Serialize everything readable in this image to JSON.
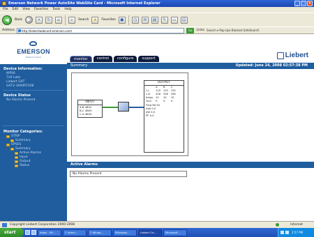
{
  "window": {
    "title": "Emerson Network Power AutoSite WebSite Card - Microsoft Internet Explorer"
  },
  "menu": [
    "File",
    "Edit",
    "View",
    "Favorites",
    "Tools",
    "Help"
  ],
  "toolbar": {
    "back": "Back",
    "search": "Search",
    "favorites": "Favorites"
  },
  "address": {
    "label": "Address",
    "url": "http://liebertwebcard.emerson.com/",
    "go": "Go",
    "links": "Links",
    "extra": "Search ▾  Pop-Ups Blocked  SafeSearch"
  },
  "brand": {
    "logo": "EMERSON",
    "logo_sub": "Network Power",
    "partner": "Liebert"
  },
  "tabs": [
    "monitor",
    "control",
    "configure",
    "support"
  ],
  "sidebar": {
    "device_info_title": "Device Information:",
    "device_info_lines": [
      "WPS6",
      "7x9 Labs",
      "Liebert GXT",
      "GXT2-3000RT208"
    ],
    "device_status_title": "Device Status",
    "device_status_value": "No Alarms Present",
    "categories_title": "Monitor Categories:",
    "tree": [
      {
        "level": 1,
        "label": "STRIP"
      },
      {
        "level": 2,
        "label": "Summary"
      },
      {
        "level": 1,
        "label": "UPS01"
      },
      {
        "level": 2,
        "label": "Summary"
      },
      {
        "level": 3,
        "label": "Active Alarms"
      },
      {
        "level": 3,
        "label": "Input"
      },
      {
        "level": 3,
        "label": "Output"
      },
      {
        "level": 3,
        "label": "Status"
      }
    ]
  },
  "summary": {
    "label": "Summary",
    "updated": "Updated: June 24, 2008 02:57:38 PM"
  },
  "diagram": {
    "input_title": "INPUT",
    "input_rows": [
      "A-B  480V",
      "B-C  480V",
      "C-A  480V"
    ],
    "output_title": "OUTPUT",
    "output_header": [
      "",
      "A",
      "B",
      "C"
    ],
    "output_rows": [
      [
        "L-L",
        "120",
        "120",
        "120"
      ],
      [
        "L-N",
        "208",
        "208",
        "208"
      ],
      [
        "Amps",
        "10",
        "10",
        "10"
      ],
      [
        "%Ld",
        "0",
        "0",
        "0"
      ]
    ],
    "output_lines": [
      "Freq  60 Hz",
      "kVA   0.0",
      "kW   0.0",
      "PF   0.0"
    ]
  },
  "alarms": {
    "label": "Active Alarms",
    "message": "No Alarms Present"
  },
  "statusbar": {
    "text": "Copyright Liebert Corporation 2000-2008",
    "zone": "Internet"
  },
  "taskbar": {
    "start": "start",
    "tasks": [
      "Inbox - Mi...",
      "2 Intern...",
      "2 Windo...",
      "Windows...",
      "Liebert Ca...",
      "Microsoft..."
    ],
    "clock": "2:57 PM"
  }
}
